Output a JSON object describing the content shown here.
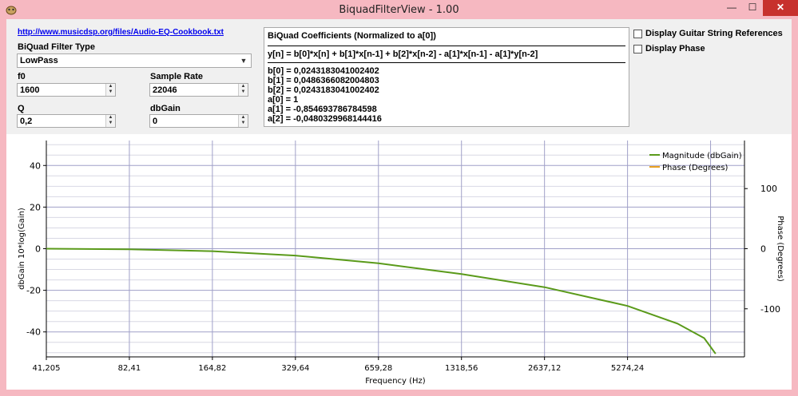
{
  "window": {
    "title": "BiquadFilterView - 1.00",
    "minimize": "—",
    "maximize": "☐",
    "close": "✕"
  },
  "link": "http://www.musicdsp.org/files/Audio-EQ-Cookbook.txt",
  "filter_type": {
    "label": "BiQuad Filter Type",
    "value": "LowPass"
  },
  "f0": {
    "label": "f0",
    "value": "1600"
  },
  "sample_rate": {
    "label": "Sample Rate",
    "value": "22046"
  },
  "q": {
    "label": "Q",
    "value": "0,2"
  },
  "dbgain": {
    "label": "dbGain",
    "value": "0"
  },
  "coefficients": {
    "heading": "BiQuad Coefficients (Normalized to a[0])",
    "equation": "y[n] = b[0]*x[n] + b[1]*x[n-1] + b[2]*x[n-2] - a[1]*x[n-1] - a[1]*y[n-2]",
    "lines": [
      "b[0] = 0,0243183041002402",
      "b[1] = 0,0486366082004803",
      "b[2] = 0,0243183041002402",
      "a[0] = 1",
      "a[1] = -0,854693786784598",
      "a[2] = -0,0480329968144416"
    ]
  },
  "options": {
    "guitar": "Display Guitar String References",
    "phase": "Display Phase"
  },
  "colors": {
    "magnitude": "#5a9a1a",
    "phase": "#e8a020",
    "grid_major": "#a0a0c8",
    "grid_minor": "#d8d8e4"
  },
  "chart_data": {
    "type": "line",
    "xlabel": "Frequency (Hz)",
    "ylabel": "dbGain 10*log(Gain)",
    "y2label": "Phase (Degrees)",
    "x_scale": "log",
    "x_ticks": [
      "41,205",
      "82,41",
      "164,82",
      "329,64",
      "659,28",
      "1318,56",
      "2637,12",
      "5274,24"
    ],
    "x_tick_values": [
      41.205,
      82.41,
      164.82,
      329.64,
      659.28,
      1318.56,
      2637.12,
      5274.24
    ],
    "xlim": [
      41.205,
      14000
    ],
    "ylim": [
      -52,
      52
    ],
    "y_ticks": [
      40,
      20,
      0,
      -20,
      -40
    ],
    "y2lim": [
      -180,
      180
    ],
    "y2_ticks": [
      100,
      0,
      -100
    ],
    "grid": true,
    "legend_position": "top-right",
    "series": [
      {
        "name": "Magnitude (dbGain)",
        "x": [
          41.205,
          82.41,
          164.82,
          329.64,
          659.28,
          1318.56,
          2637.12,
          5274.24,
          8000,
          10000,
          11000
        ],
        "y": [
          0,
          -0.3,
          -1.2,
          -3.3,
          -7.0,
          -12.2,
          -18.5,
          -27.5,
          -36.0,
          -43.0,
          -50.5
        ]
      },
      {
        "name": "Phase (Degrees)",
        "x": [],
        "y": []
      }
    ]
  }
}
